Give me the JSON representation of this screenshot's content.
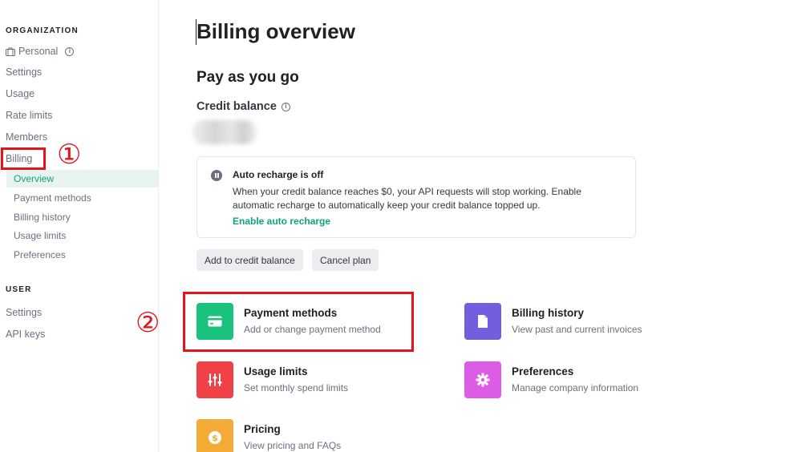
{
  "sidebar": {
    "org_title": "ORGANIZATION",
    "org_name": "Personal",
    "items": [
      {
        "label": "Settings"
      },
      {
        "label": "Usage"
      },
      {
        "label": "Rate limits"
      },
      {
        "label": "Members"
      },
      {
        "label": "Billing"
      }
    ],
    "billing_sub": [
      {
        "label": "Overview",
        "active": true
      },
      {
        "label": "Payment methods"
      },
      {
        "label": "Billing history"
      },
      {
        "label": "Usage limits"
      },
      {
        "label": "Preferences"
      }
    ],
    "user_title": "USER",
    "user_items": [
      {
        "label": "Settings"
      },
      {
        "label": "API keys"
      }
    ]
  },
  "annotations": {
    "marker_1": "①",
    "marker_2": "②",
    "color": "#e5141b"
  },
  "main": {
    "title": "Billing overview",
    "section": "Pay as you go",
    "credit_label": "Credit balance",
    "notice": {
      "title": "Auto recharge is off",
      "body": "When your credit balance reaches $0, your API requests will stop working. Enable automatic recharge to automatically keep your credit balance topped up.",
      "link": "Enable auto recharge"
    },
    "buttons": {
      "add_credit": "Add to credit balance",
      "cancel": "Cancel plan"
    },
    "cards": [
      {
        "title": "Payment methods",
        "desc": "Add or change payment method",
        "icon": "credit-card-icon",
        "color": "#19c37d"
      },
      {
        "title": "Billing history",
        "desc": "View past and current invoices",
        "icon": "document-icon",
        "color": "#715fde"
      },
      {
        "title": "Usage limits",
        "desc": "Set monthly spend limits",
        "icon": "sliders-icon",
        "color": "#ef4146"
      },
      {
        "title": "Preferences",
        "desc": "Manage company information",
        "icon": "gear-icon",
        "color": "#dd5ce5"
      },
      {
        "title": "Pricing",
        "desc": "View pricing and FAQs",
        "icon": "dollar-icon",
        "color": "#f4ac36"
      }
    ]
  }
}
